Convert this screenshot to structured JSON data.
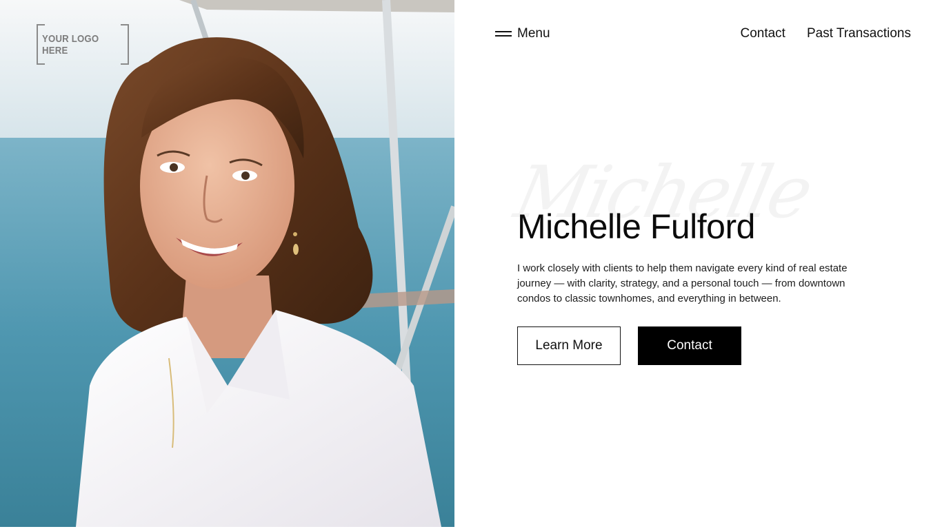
{
  "logo": {
    "text": "YOUR LOGO HERE"
  },
  "nav": {
    "menu_icon": "hamburger-icon",
    "menu_label": "Menu",
    "links": [
      {
        "label": "Contact"
      },
      {
        "label": "Past Transactions"
      }
    ]
  },
  "hero": {
    "script_text": "Michelle",
    "title": "Michelle Fulford",
    "description": "I work closely with clients to help them navigate every kind of real estate journey — with clarity, strategy, and a personal touch — from downtown condos to classic townhomes, and everything in between.",
    "buttons": {
      "learn_more": "Learn More",
      "contact": "Contact"
    }
  },
  "colors": {
    "primary_button_bg": "#000000",
    "primary_button_text": "#ffffff",
    "text": "#111111",
    "background": "#ffffff"
  }
}
